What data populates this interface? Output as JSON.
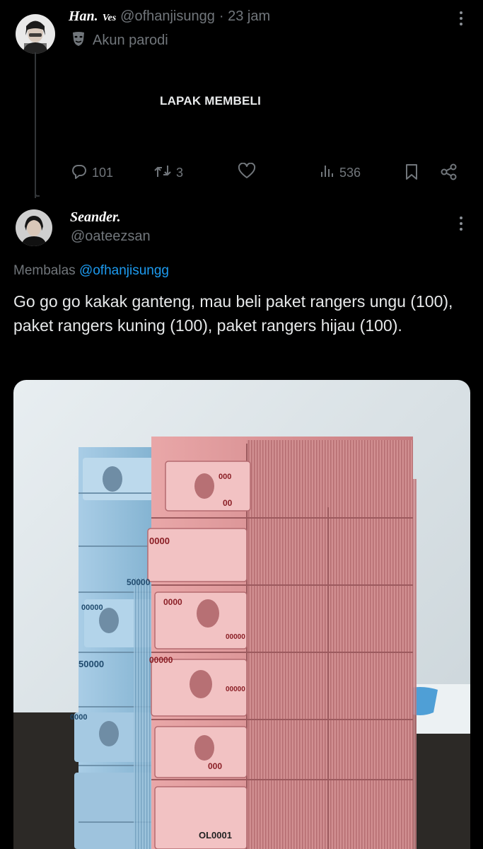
{
  "original_post": {
    "display_name": "Han.",
    "name_suffix": "Ves",
    "handle": "@ofhanjisungg",
    "time": "· 23 jam",
    "parody_label": "Akun parodi",
    "body_text": "LAPAK MEMBELI",
    "stats": {
      "replies": "101",
      "reposts": "3",
      "views": "536"
    }
  },
  "reply_post": {
    "display_name": "Seander.",
    "handle": "@oateezsan",
    "replying_prefix": "Membalas",
    "replying_to": "@ofhanjisungg",
    "body_text": "Go go go kakak ganteng, mau beli paket rangers ungu (100), paket rangers kuning (100), paket rangers hijau (100)."
  },
  "photo": {
    "banknote_text": [
      "0000",
      "00",
      "50000",
      "0000",
      "50000",
      "00000",
      "0000",
      "00000",
      "000",
      "00000",
      "00000",
      "000",
      "OL0001"
    ]
  },
  "colors": {
    "background": "#000000",
    "text_primary": "#e7e9ea",
    "text_secondary": "#71767b",
    "link": "#1d9bf0",
    "thread_line": "#333639"
  },
  "icons": [
    "parody-mask-icon",
    "reply-icon",
    "repost-icon",
    "like-icon",
    "views-icon",
    "bookmark-icon",
    "share-icon",
    "more-icon"
  ]
}
